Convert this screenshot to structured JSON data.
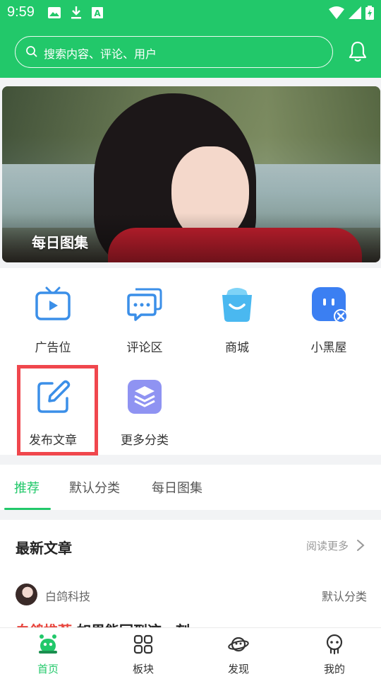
{
  "status_bar": {
    "time": "9:59"
  },
  "search": {
    "placeholder": "搜索内容、评论、用户"
  },
  "banner": {
    "caption": "每日图集"
  },
  "grid": {
    "items": [
      {
        "label": "广告位",
        "icon": "tv-icon",
        "color": "#3b8fe8"
      },
      {
        "label": "评论区",
        "icon": "chat-icon",
        "color": "#3b8fe8"
      },
      {
        "label": "商城",
        "icon": "shop-bag-icon",
        "color": "#4ab8f0"
      },
      {
        "label": "小黑屋",
        "icon": "face-block-icon",
        "color": "#3b7ff2"
      },
      {
        "label": "发布文章",
        "icon": "edit-icon",
        "color": "#3b8fe8"
      },
      {
        "label": "更多分类",
        "icon": "layers-icon",
        "color": "#8f93f2"
      }
    ]
  },
  "tabs": [
    {
      "label": "推荐",
      "active": true
    },
    {
      "label": "默认分类",
      "active": false
    },
    {
      "label": "每日图集",
      "active": false
    }
  ],
  "section": {
    "title": "最新文章",
    "read_more": "阅读更多",
    "article": {
      "author": "白鸽科技",
      "category": "默认分类",
      "tag": "白鸽推荐",
      "title": "如果能回到这一刻"
    }
  },
  "bottom_nav": [
    {
      "label": "首页",
      "icon": "home-robot-icon",
      "active": true
    },
    {
      "label": "板块",
      "icon": "grid-icon",
      "active": false
    },
    {
      "label": "发现",
      "icon": "planet-icon",
      "active": false
    },
    {
      "label": "我的",
      "icon": "profile-icon",
      "active": false
    }
  ],
  "colors": {
    "brand": "#22c86a",
    "highlight": "#f0474d",
    "tag": "#e8463e"
  }
}
